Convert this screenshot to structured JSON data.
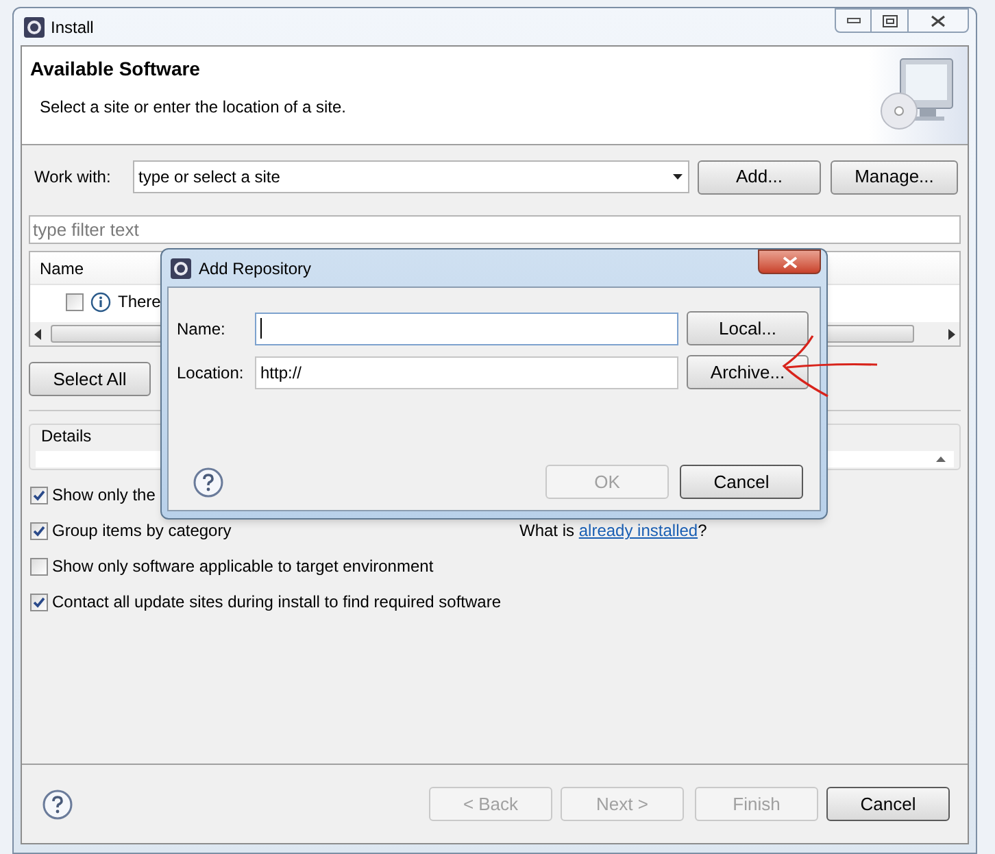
{
  "window": {
    "title": "Install"
  },
  "header": {
    "title": "Available Software",
    "subtitle": "Select a site or enter the location of a site."
  },
  "work_with": {
    "label": "Work with:",
    "placeholder": "type or select a site",
    "buttons": [
      "Add...",
      "Manage..."
    ]
  },
  "filter": {
    "placeholder": "type filter text"
  },
  "table": {
    "columns": [
      "Name"
    ],
    "rows": [
      {
        "checked": false,
        "text": "There"
      }
    ]
  },
  "select_all": "Select All",
  "details": {
    "title": "Details"
  },
  "options": [
    {
      "label": "Show only the",
      "checked": true
    },
    {
      "label": "Group items by category",
      "checked": true
    },
    {
      "label": "Show only software applicable to target environment",
      "checked": false
    },
    {
      "label": "Contact all update sites during install to find required software",
      "checked": true
    }
  ],
  "installed_link": {
    "prefix": "What is",
    "link": "already installed",
    "suffix": "?"
  },
  "footer": {
    "buttons": [
      {
        "label": "< Back",
        "disabled": true
      },
      {
        "label": "Next >",
        "disabled": true
      },
      {
        "label": "Finish",
        "disabled": true
      },
      {
        "label": "Cancel",
        "disabled": false
      }
    ]
  },
  "dialog": {
    "title": "Add Repository",
    "fields": [
      {
        "label": "Name:",
        "focused": true,
        "button": "Local..."
      },
      {
        "label": "Location:",
        "value": "http://",
        "focused": false,
        "button": "Archive..."
      }
    ],
    "buttons": [
      {
        "label": "OK",
        "disabled": true
      },
      {
        "label": "Cancel",
        "disabled": false
      }
    ]
  }
}
